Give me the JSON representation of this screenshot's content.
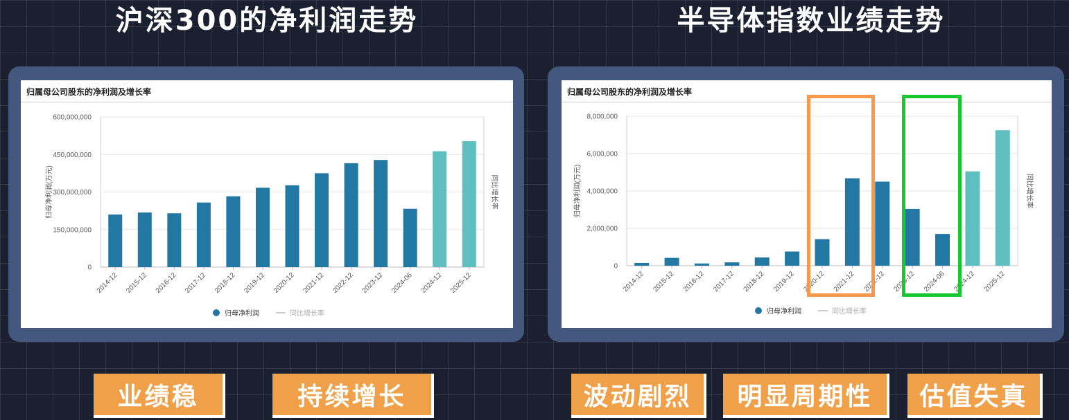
{
  "headlines": {
    "left": "沪深300的净利润走势",
    "right": "半导体指数业绩走势"
  },
  "tags": {
    "left": [
      "业绩稳",
      "持续增长"
    ],
    "right": [
      "波动剧烈",
      "明显周期性",
      "估值失真"
    ]
  },
  "colors": {
    "actual_bar": "#2277a3",
    "forecast_bar": "#5fbec0",
    "tag_bg": "#f0a048",
    "highlight_orange": "#f59a4c",
    "highlight_green": "#18c832",
    "frame": "#44587f"
  },
  "chart_data": [
    {
      "type": "bar",
      "title": "归属母公司股东的净利润及增长率",
      "categories": [
        "2014-12",
        "2015-12",
        "2016-12",
        "2017-12",
        "2018-12",
        "2019-12",
        "2020-12",
        "2021-12",
        "2022-12",
        "2023-12",
        "2024-06",
        "2024-12",
        "2025-12"
      ],
      "series": [
        {
          "name": "归母净利润",
          "values": [
            210000000,
            218000000,
            215000000,
            258000000,
            283000000,
            317000000,
            327000000,
            375000000,
            415000000,
            428000000,
            233000000,
            463000000,
            503000000
          ]
        },
        {
          "name": "同比增长率",
          "values": []
        }
      ],
      "forecast_from_index": 11,
      "ylabel": "归母净利润(万元)",
      "y2label": "同比增长率",
      "ylim": [
        0,
        600000000
      ],
      "yticks": [
        "0",
        "150,000,000",
        "300,000,000",
        "450,000,000",
        "600,000,000"
      ],
      "grid": true,
      "legend": "bottom"
    },
    {
      "type": "bar",
      "title": "归属母公司股东的净利润及增长率",
      "categories": [
        "2014-12",
        "2015-12",
        "2016-12",
        "2017-12",
        "2018-12",
        "2019-12",
        "2020-12",
        "2021-12",
        "2022-12",
        "2023-12",
        "2024-06",
        "2024-12",
        "2025-12"
      ],
      "series": [
        {
          "name": "归母净利润",
          "values": [
            150000,
            420000,
            120000,
            180000,
            440000,
            760000,
            1420000,
            4680000,
            4500000,
            3040000,
            1700000,
            5050000,
            7250000
          ]
        },
        {
          "name": "同比增长率",
          "values": []
        }
      ],
      "forecast_from_index": 11,
      "ylabel": "归母净利润(万元)",
      "y2label": "同比增长率",
      "ylim": [
        0,
        8000000
      ],
      "yticks": [
        "0",
        "2,000,000",
        "4,000,000",
        "6,000,000",
        "8,000,000"
      ],
      "grid": true,
      "legend": "bottom",
      "highlights": [
        {
          "from": "2020-12",
          "to": "2021-12",
          "color": "orange"
        },
        {
          "from": "2023-12",
          "to": "2024-06",
          "color": "green"
        }
      ]
    }
  ]
}
